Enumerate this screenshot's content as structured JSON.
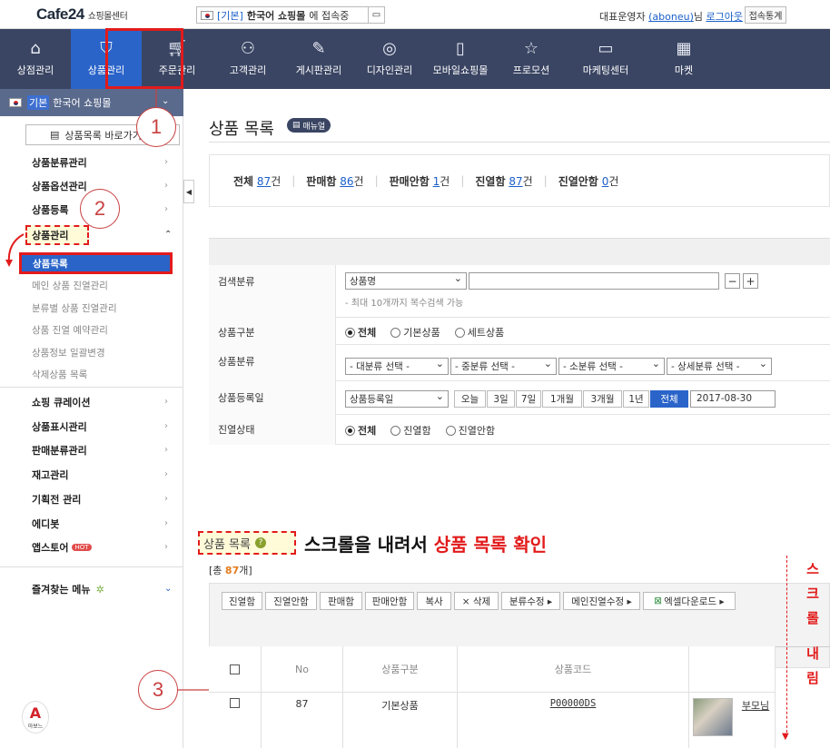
{
  "topbar": {
    "logo": "Cafe24",
    "logo_sub": "쇼핑몰센터",
    "mall_tag": "[기본]",
    "mall_name": "한국어 쇼핑몰",
    "mall_suffix": "에 접속중",
    "user_prefix": "대표운영자",
    "user_id": "(aboneu)",
    "user_suffix": "님",
    "logout": "로그아웃",
    "stats_button": "접속통계"
  },
  "nav": {
    "items": [
      {
        "label": "상점관리",
        "icon": "home-icon"
      },
      {
        "label": "상품관리",
        "icon": "shirt-icon"
      },
      {
        "label": "주문관리",
        "icon": "cart-icon"
      },
      {
        "label": "고객관리",
        "icon": "users-icon"
      },
      {
        "label": "게시판관리",
        "icon": "board-icon"
      },
      {
        "label": "디자인관리",
        "icon": "palette-icon"
      },
      {
        "label": "모바일쇼핑몰",
        "icon": "mobile-icon"
      },
      {
        "label": "프로모션",
        "icon": "star-icon"
      },
      {
        "label": "마케팅센터",
        "icon": "monitor-icon"
      },
      {
        "label": "마켓",
        "icon": "market-icon"
      }
    ]
  },
  "sidebar": {
    "mall_tag": "기본",
    "mall_name": "한국어 쇼핑몰",
    "list_button": "상품목록 바로가기",
    "menus_top": [
      "상품분류관리",
      "상품옵션관리",
      "상품등록"
    ],
    "active_menu": "상품관리",
    "subitems": [
      "상품목록",
      "메인 상품 진열관리",
      "분류별 상품 진열관리",
      "상품 진열 예약관리",
      "상품정보 일괄변경",
      "삭제상품 목록"
    ],
    "menus_bottom": [
      "쇼핑 큐레이션",
      "상품표시관리",
      "판매분류관리",
      "재고관리",
      "기획전 관리",
      "에디봇",
      "앱스토어"
    ],
    "hot_badge": "HOT",
    "favorites": "즐겨찾는 메뉴",
    "brand_mark": "아보느"
  },
  "annotations": {
    "step1": "1",
    "step2": "2",
    "step3": "3",
    "scroll_message_black": "스크롤을 내려서",
    "scroll_message_red": "상품 목록 확인",
    "vertical_text": [
      "스",
      "크",
      "롤",
      "",
      "내",
      "림"
    ]
  },
  "main": {
    "title": "상품 목록",
    "manual": "매뉴얼",
    "summary": [
      {
        "label": "전체",
        "count": "87",
        "unit": "건"
      },
      {
        "label": "판매함",
        "count": "86",
        "unit": "건"
      },
      {
        "label": "판매안함",
        "count": "1",
        "unit": "건"
      },
      {
        "label": "진열함",
        "count": "87",
        "unit": "건"
      },
      {
        "label": "진열안함",
        "count": "0",
        "unit": "건"
      }
    ],
    "search": {
      "category_label": "검색분류",
      "category_value": "상품명",
      "category_hint": "- 최대 10개까지 복수검색 가능",
      "minus": "−",
      "plus": "+",
      "type_label": "상품구분",
      "type_options": [
        "전체",
        "기본상품",
        "세트상품"
      ],
      "class_label": "상품분류",
      "class_selects": [
        "- 대분류 선택 -",
        "- 중분류 선택 -",
        "- 소분류 선택 -",
        "- 상세분류 선택 -"
      ],
      "date_label": "상품등록일",
      "date_select": "상품등록일",
      "date_buttons": [
        "오늘",
        "3일",
        "7일",
        "1개월",
        "3개월",
        "1년",
        "전체"
      ],
      "date_value": "2017-08-30",
      "display_label": "진열상태",
      "display_options": [
        "전체",
        "진열함",
        "진열안함"
      ]
    },
    "list": {
      "title": "상품 목록",
      "total_prefix": "[총 ",
      "total_count": "87",
      "total_suffix": "개]",
      "buttons": [
        "진열함",
        "진열안함",
        "판매함",
        "판매안함",
        "복사",
        "× 삭제",
        "분류수정 ▸",
        "메인진열수정 ▸",
        "엑셀다운로드 ▸"
      ],
      "columns": [
        "No",
        "상품구분",
        "상품코드"
      ],
      "row": {
        "no": "87",
        "type": "기본상품",
        "code": "P00000DS",
        "name": "부모님"
      }
    }
  }
}
